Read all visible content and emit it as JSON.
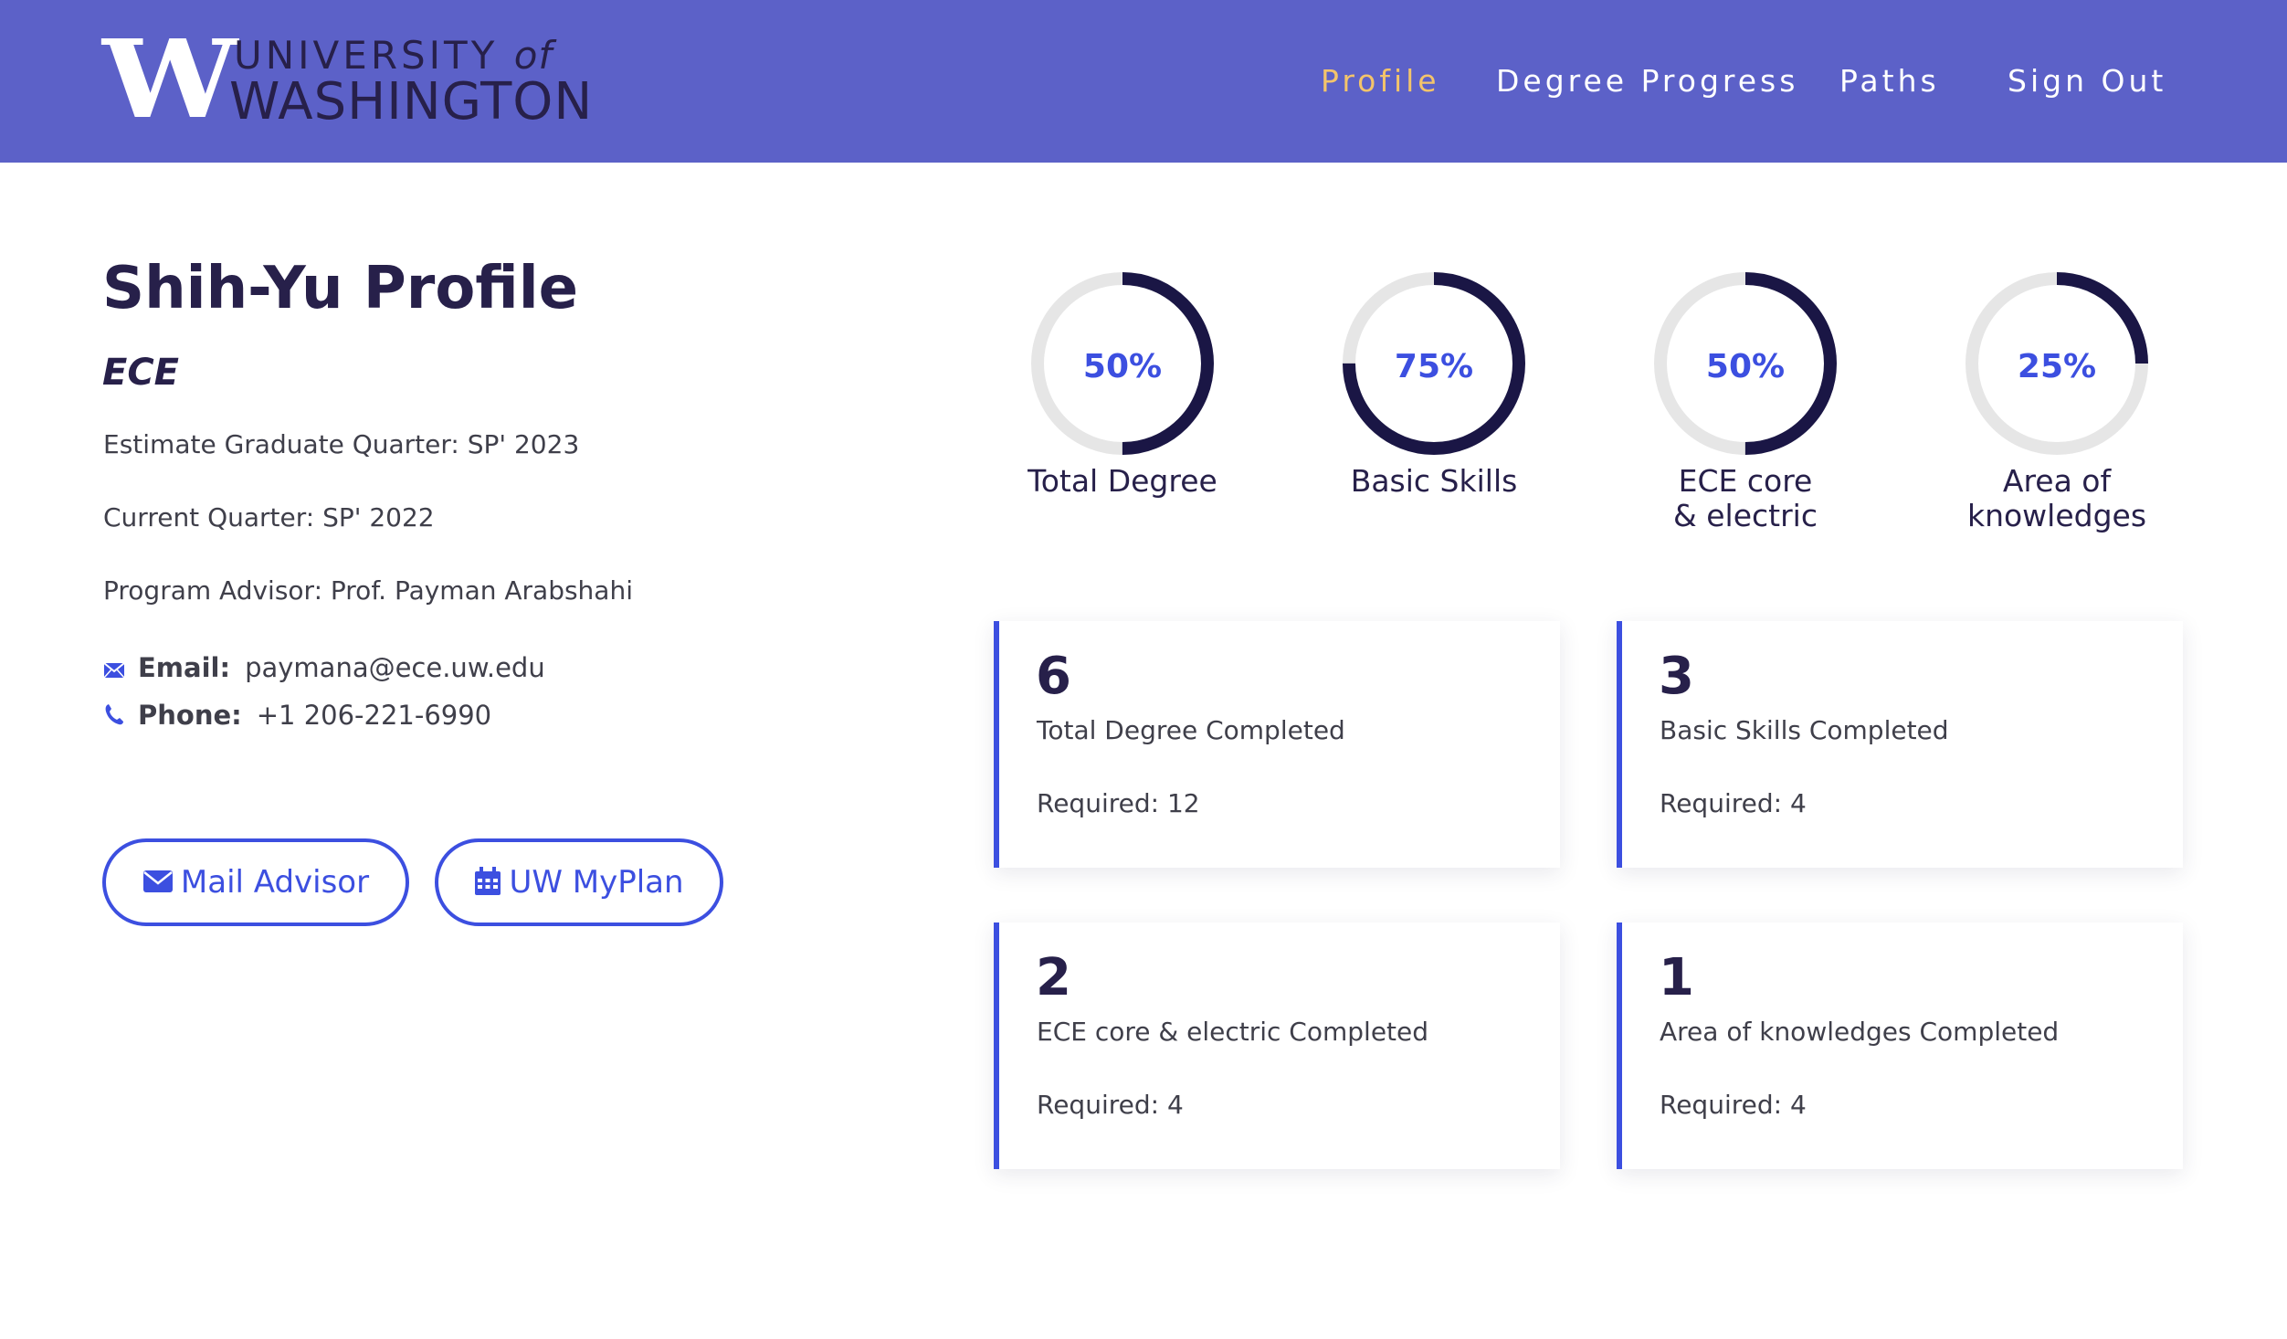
{
  "header": {
    "logo_letter": "W",
    "logo_line1": "UNIVERSITY",
    "logo_of": "of",
    "logo_line2": "WASHINGTON",
    "nav": [
      "Profile",
      "Degree Progress",
      "Paths",
      "Sign Out"
    ],
    "active_nav": "Profile",
    "bar_color": "#5c61c8",
    "active_color": "#f3c46b"
  },
  "profile": {
    "title": "Shih-Yu Profile",
    "major": "ECE",
    "graduate_quarter": "Estimate Graduate Quarter: SP' 2023",
    "current_quarter": "Current Quarter: SP' 2022",
    "advisor": "Program Advisor: Prof. Payman Arabshahi",
    "email_label": "Email:",
    "email": "paymana@ece.uw.edu",
    "phone_label": "Phone:",
    "phone": "+1 206-221-6990",
    "mail_button": "Mail Advisor",
    "myplan_button": "UW MyPlan",
    "accent_color": "#3c4fe0"
  },
  "progress": [
    {
      "label": "Total Degree",
      "percent_text": "50%",
      "fraction": 0.5
    },
    {
      "label": "Basic Skills",
      "percent_text": "75%",
      "fraction": 0.75
    },
    {
      "label": "ECE core & electric",
      "percent_text": "50%",
      "fraction": 0.5
    },
    {
      "label": "Area of knowledges",
      "percent_text": "25%",
      "fraction": 0.25
    }
  ],
  "stats": [
    {
      "count": "6",
      "description": "Total Degree Completed",
      "required": "Required: 12"
    },
    {
      "count": "3",
      "description": "Basic Skills Completed",
      "required": "Required: 4"
    },
    {
      "count": "2",
      "description": "ECE core & electric Completed",
      "required": "Required: 4"
    },
    {
      "count": "1",
      "description": "Area of knowledges Completed",
      "required": "Required: 4"
    }
  ]
}
